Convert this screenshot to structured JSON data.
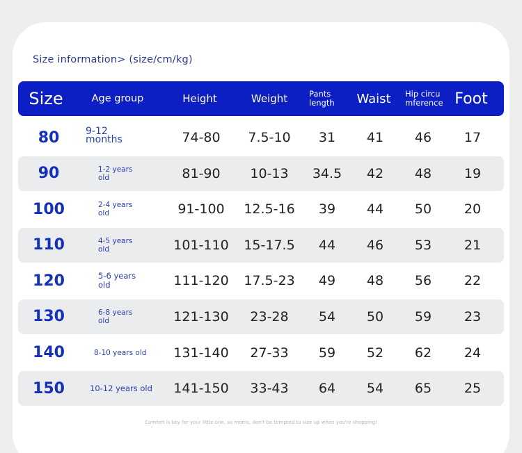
{
  "title": "Size information> (size/cm/kg)",
  "header": {
    "size": "Size",
    "age_group": "Age group",
    "height": "Height",
    "weight": "Weight",
    "pants_length_1": "Pants",
    "pants_length_2": "length",
    "waist": "Waist",
    "hip_1": "Hip circu",
    "hip_2": "mference",
    "foot": "Foot"
  },
  "rows": [
    {
      "size": "80",
      "age_1": "9-12 months",
      "age_2": "",
      "height": "74-80",
      "weight": "7.5-10",
      "pants": "31",
      "waist": "41",
      "hip": "46",
      "foot": "17"
    },
    {
      "size": "90",
      "age_1": "1-2 years",
      "age_2": "old",
      "height": "81-90",
      "weight": "10-13",
      "pants": "34.5",
      "waist": "42",
      "hip": "48",
      "foot": "19"
    },
    {
      "size": "100",
      "age_1": "2-4 years",
      "age_2": "old",
      "height": "91-100",
      "weight": "12.5-16",
      "pants": "39",
      "waist": "44",
      "hip": "50",
      "foot": "20"
    },
    {
      "size": "110",
      "age_1": "4-5 years",
      "age_2": "old",
      "height": "101-110",
      "weight": "15-17.5",
      "pants": "44",
      "waist": "46",
      "hip": "53",
      "foot": "21"
    },
    {
      "size": "120",
      "age_1": "5-6 years",
      "age_2": "old",
      "height": "111-120",
      "weight": "17.5-23",
      "pants": "49",
      "waist": "48",
      "hip": "56",
      "foot": "22"
    },
    {
      "size": "130",
      "age_1": "6-8 years",
      "age_2": "old",
      "height": "121-130",
      "weight": "23-28",
      "pants": "54",
      "waist": "50",
      "hip": "59",
      "foot": "23"
    },
    {
      "size": "140",
      "age_1": "8-10 years old",
      "age_2": "",
      "height": "131-140",
      "weight": "27-33",
      "pants": "59",
      "waist": "52",
      "hip": "62",
      "foot": "24"
    },
    {
      "size": "150",
      "age_1": "10-12 years old",
      "age_2": "",
      "height": "141-150",
      "weight": "33-43",
      "pants": "64",
      "waist": "54",
      "hip": "65",
      "foot": "25"
    }
  ],
  "footer": "Comfort is key for your little one, so moms, don't be tempted to size up when you're shopping!",
  "colors": {
    "header_bg": "#0b1fc4",
    "size_text": "#1530b8",
    "row_shade": "#ebecee"
  }
}
